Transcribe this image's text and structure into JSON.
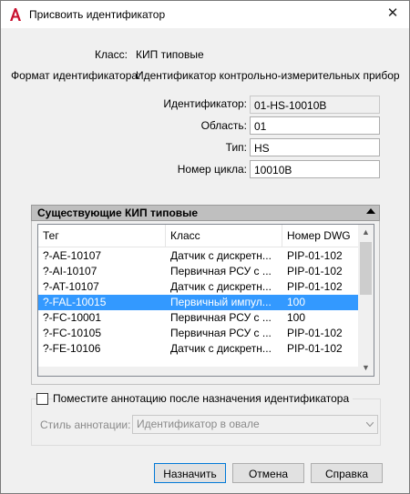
{
  "window": {
    "title": "Присвоить идентификатор",
    "close_glyph": "✕",
    "app_icon": "autocad-a-icon"
  },
  "info": {
    "class_label": "Класс:",
    "class_value": "КИП типовые",
    "format_label": "Формат идентификатора:",
    "format_value": "Идентификатор  контрольно-измерительных  приборо..."
  },
  "fields": {
    "identifier": {
      "label": "Идентификатор:",
      "value": "01-HS-10010B"
    },
    "area": {
      "label": "Область:",
      "value": "01"
    },
    "type": {
      "label": "Тип:",
      "value": "HS"
    },
    "loop": {
      "label": "Номер цикла:",
      "value": "10010B"
    }
  },
  "existing": {
    "header": "Существующие КИП типовые",
    "columns": [
      "Тег",
      "Класс",
      "Номер DWG"
    ],
    "rows": [
      {
        "tag": "?-AE-10107",
        "class": "Датчик с дискретн...",
        "dwg": "PIP-01-102",
        "selected": false
      },
      {
        "tag": "?-AI-10107",
        "class": "Первичная РСУ с ...",
        "dwg": "PIP-01-102",
        "selected": false
      },
      {
        "tag": "?-AT-10107",
        "class": "Датчик с дискретн...",
        "dwg": "PIP-01-102",
        "selected": false
      },
      {
        "tag": "?-FAL-10015",
        "class": "Первичный импул...",
        "dwg": "100",
        "selected": true
      },
      {
        "tag": "?-FC-10001",
        "class": "Первичная РСУ с ...",
        "dwg": "100",
        "selected": false
      },
      {
        "tag": "?-FC-10105",
        "class": "Первичная РСУ с ...",
        "dwg": "PIP-01-102",
        "selected": false
      },
      {
        "tag": "?-FE-10106",
        "class": "Датчик с дискретн...",
        "dwg": "PIP-01-102",
        "selected": false
      }
    ]
  },
  "annotation": {
    "checkbox_label": "Поместите аннотацию после назначения идентификатора",
    "checked": false,
    "style_label": "Стиль аннотации:",
    "style_value": "Идентификатор в овале"
  },
  "buttons": {
    "assign": "Назначить",
    "cancel": "Отмена",
    "help": "Справка"
  },
  "colors": {
    "selection": "#3399ff",
    "accent": "#0078d7",
    "app_icon": "#c8102e"
  }
}
